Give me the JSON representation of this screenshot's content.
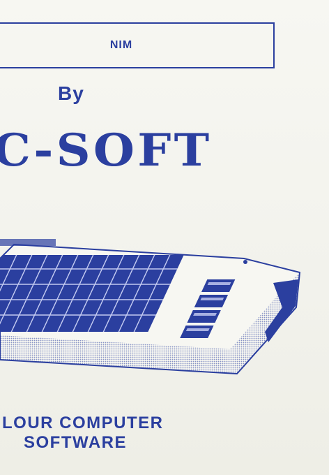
{
  "header": {
    "game_title": "NIM",
    "byline": "By"
  },
  "brand": {
    "name": "C-SOFT"
  },
  "illustration": {
    "icon": "computer-keyboard-illustration"
  },
  "footer": {
    "line1": "LOUR COMPUTER",
    "line2": "SOFTWARE"
  },
  "colors": {
    "ink": "#2b3f9f",
    "paper": "#f4f4ee"
  }
}
